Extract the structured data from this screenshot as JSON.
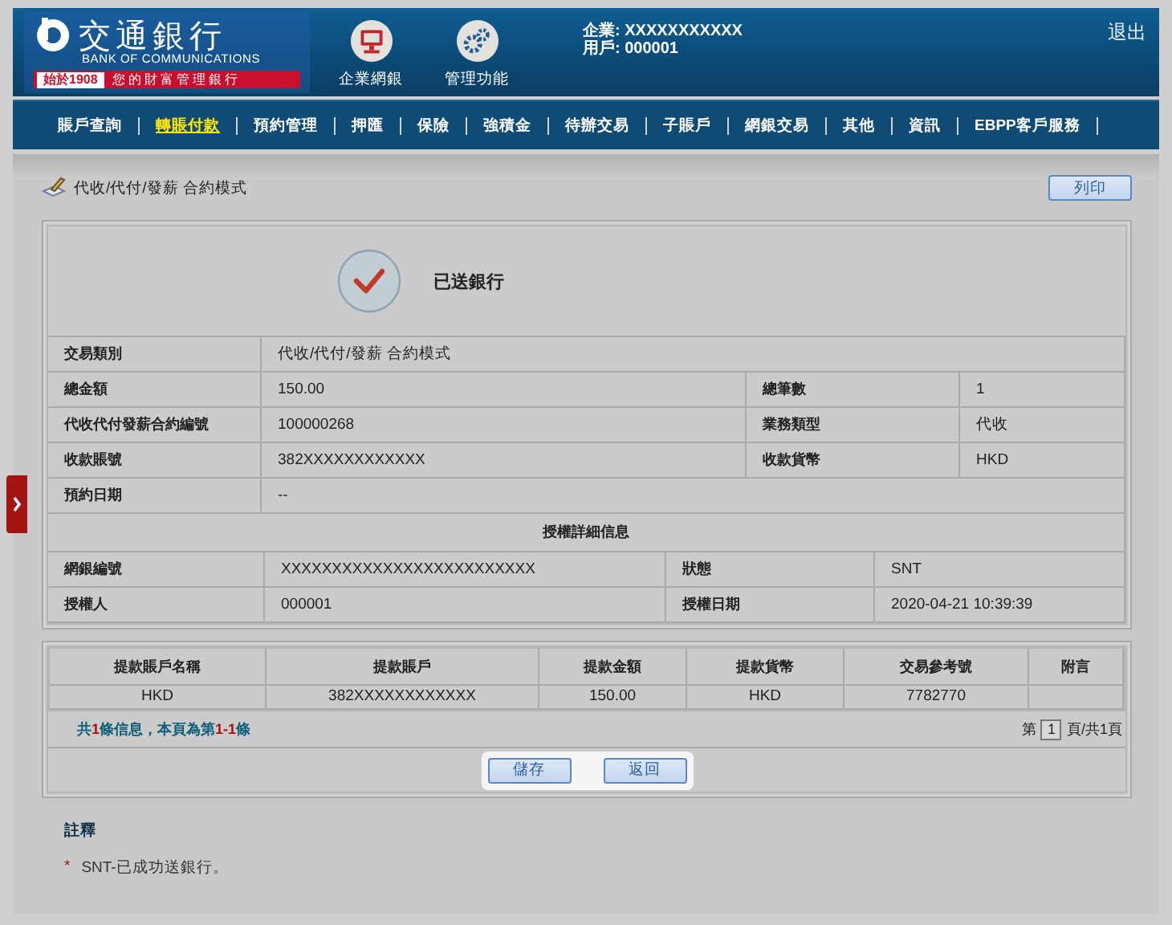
{
  "header": {
    "logo": {
      "name": "交通銀行",
      "english": "BANK OF COMMUNICATIONS",
      "since": "始於1908",
      "slogan": "您的財富管理銀行"
    },
    "apps": [
      {
        "label": "企業網銀",
        "kind": "monitor"
      },
      {
        "label": "管理功能",
        "kind": "gears"
      }
    ],
    "company": "企業: XXXXXXXXXXX",
    "user": "用戶: 000001",
    "logout": "退出"
  },
  "nav": {
    "items": [
      {
        "label": "賬戶查詢",
        "selected": false
      },
      {
        "label": "轉賬付款",
        "selected": true
      },
      {
        "label": "預約管理",
        "selected": false
      },
      {
        "label": "押匯",
        "selected": false
      },
      {
        "label": "保險",
        "selected": false
      },
      {
        "label": "強積金",
        "selected": false
      },
      {
        "label": "待辦交易",
        "selected": false
      },
      {
        "label": "子賬戶",
        "selected": false
      },
      {
        "label": "網銀交易",
        "selected": false
      },
      {
        "label": "其他",
        "selected": false
      },
      {
        "label": "資訊",
        "selected": false
      },
      {
        "label": "EBPP客戶服務",
        "selected": false
      }
    ]
  },
  "page": {
    "title": "代收/代付/發薪 合約模式",
    "print_button": "列印"
  },
  "result": {
    "status": "已送銀行",
    "rows": [
      {
        "label": "交易類別",
        "value": "代收/代付/發薪 合約模式"
      },
      {
        "label": "總金額",
        "value": "150.00",
        "label_2": "總筆數",
        "value_2": "1"
      },
      {
        "label": "代收代付發薪合約編號",
        "value": "100000268",
        "label_2": "業務類型",
        "value_2": "代收"
      },
      {
        "label": "收款賬號",
        "value": "382XXXXXXXXXXXX",
        "label_2": "收款貨幣",
        "value_2": "HKD"
      },
      {
        "label": "預約日期",
        "value": "--"
      }
    ],
    "auth": {
      "heading": "授權詳細信息",
      "rows": [
        {
          "label": "網銀編號",
          "value": "XXXXXXXXXXXXXXXXXXXXXXXXX",
          "label_2": "狀態",
          "value_2": "SNT"
        },
        {
          "label": "授權人",
          "value": "000001",
          "label_2": "授權日期",
          "value_2": "2020-04-21 10:39:39"
        }
      ]
    }
  },
  "table": {
    "columns": [
      "提款賬戶名稱",
      "提款賬戶",
      "提款金額",
      "提款貨幣",
      "交易參考號",
      "附言"
    ],
    "rows": [
      [
        "HKD",
        "382XXXXXXXXXXXX",
        "150.00",
        "HKD",
        "7782770"
      ]
    ],
    "summary": "共**1**條信息，本頁為第**1-1**條",
    "pager": {
      "before": "第",
      "page": "1",
      "after": "頁/共1頁"
    }
  },
  "buttons": [
    "儲存",
    "返回"
  ],
  "notes": {
    "title": "註釋",
    "items": [
      {
        "mark": "*",
        "text": "SNT-已成功送銀行。"
      }
    ]
  }
}
